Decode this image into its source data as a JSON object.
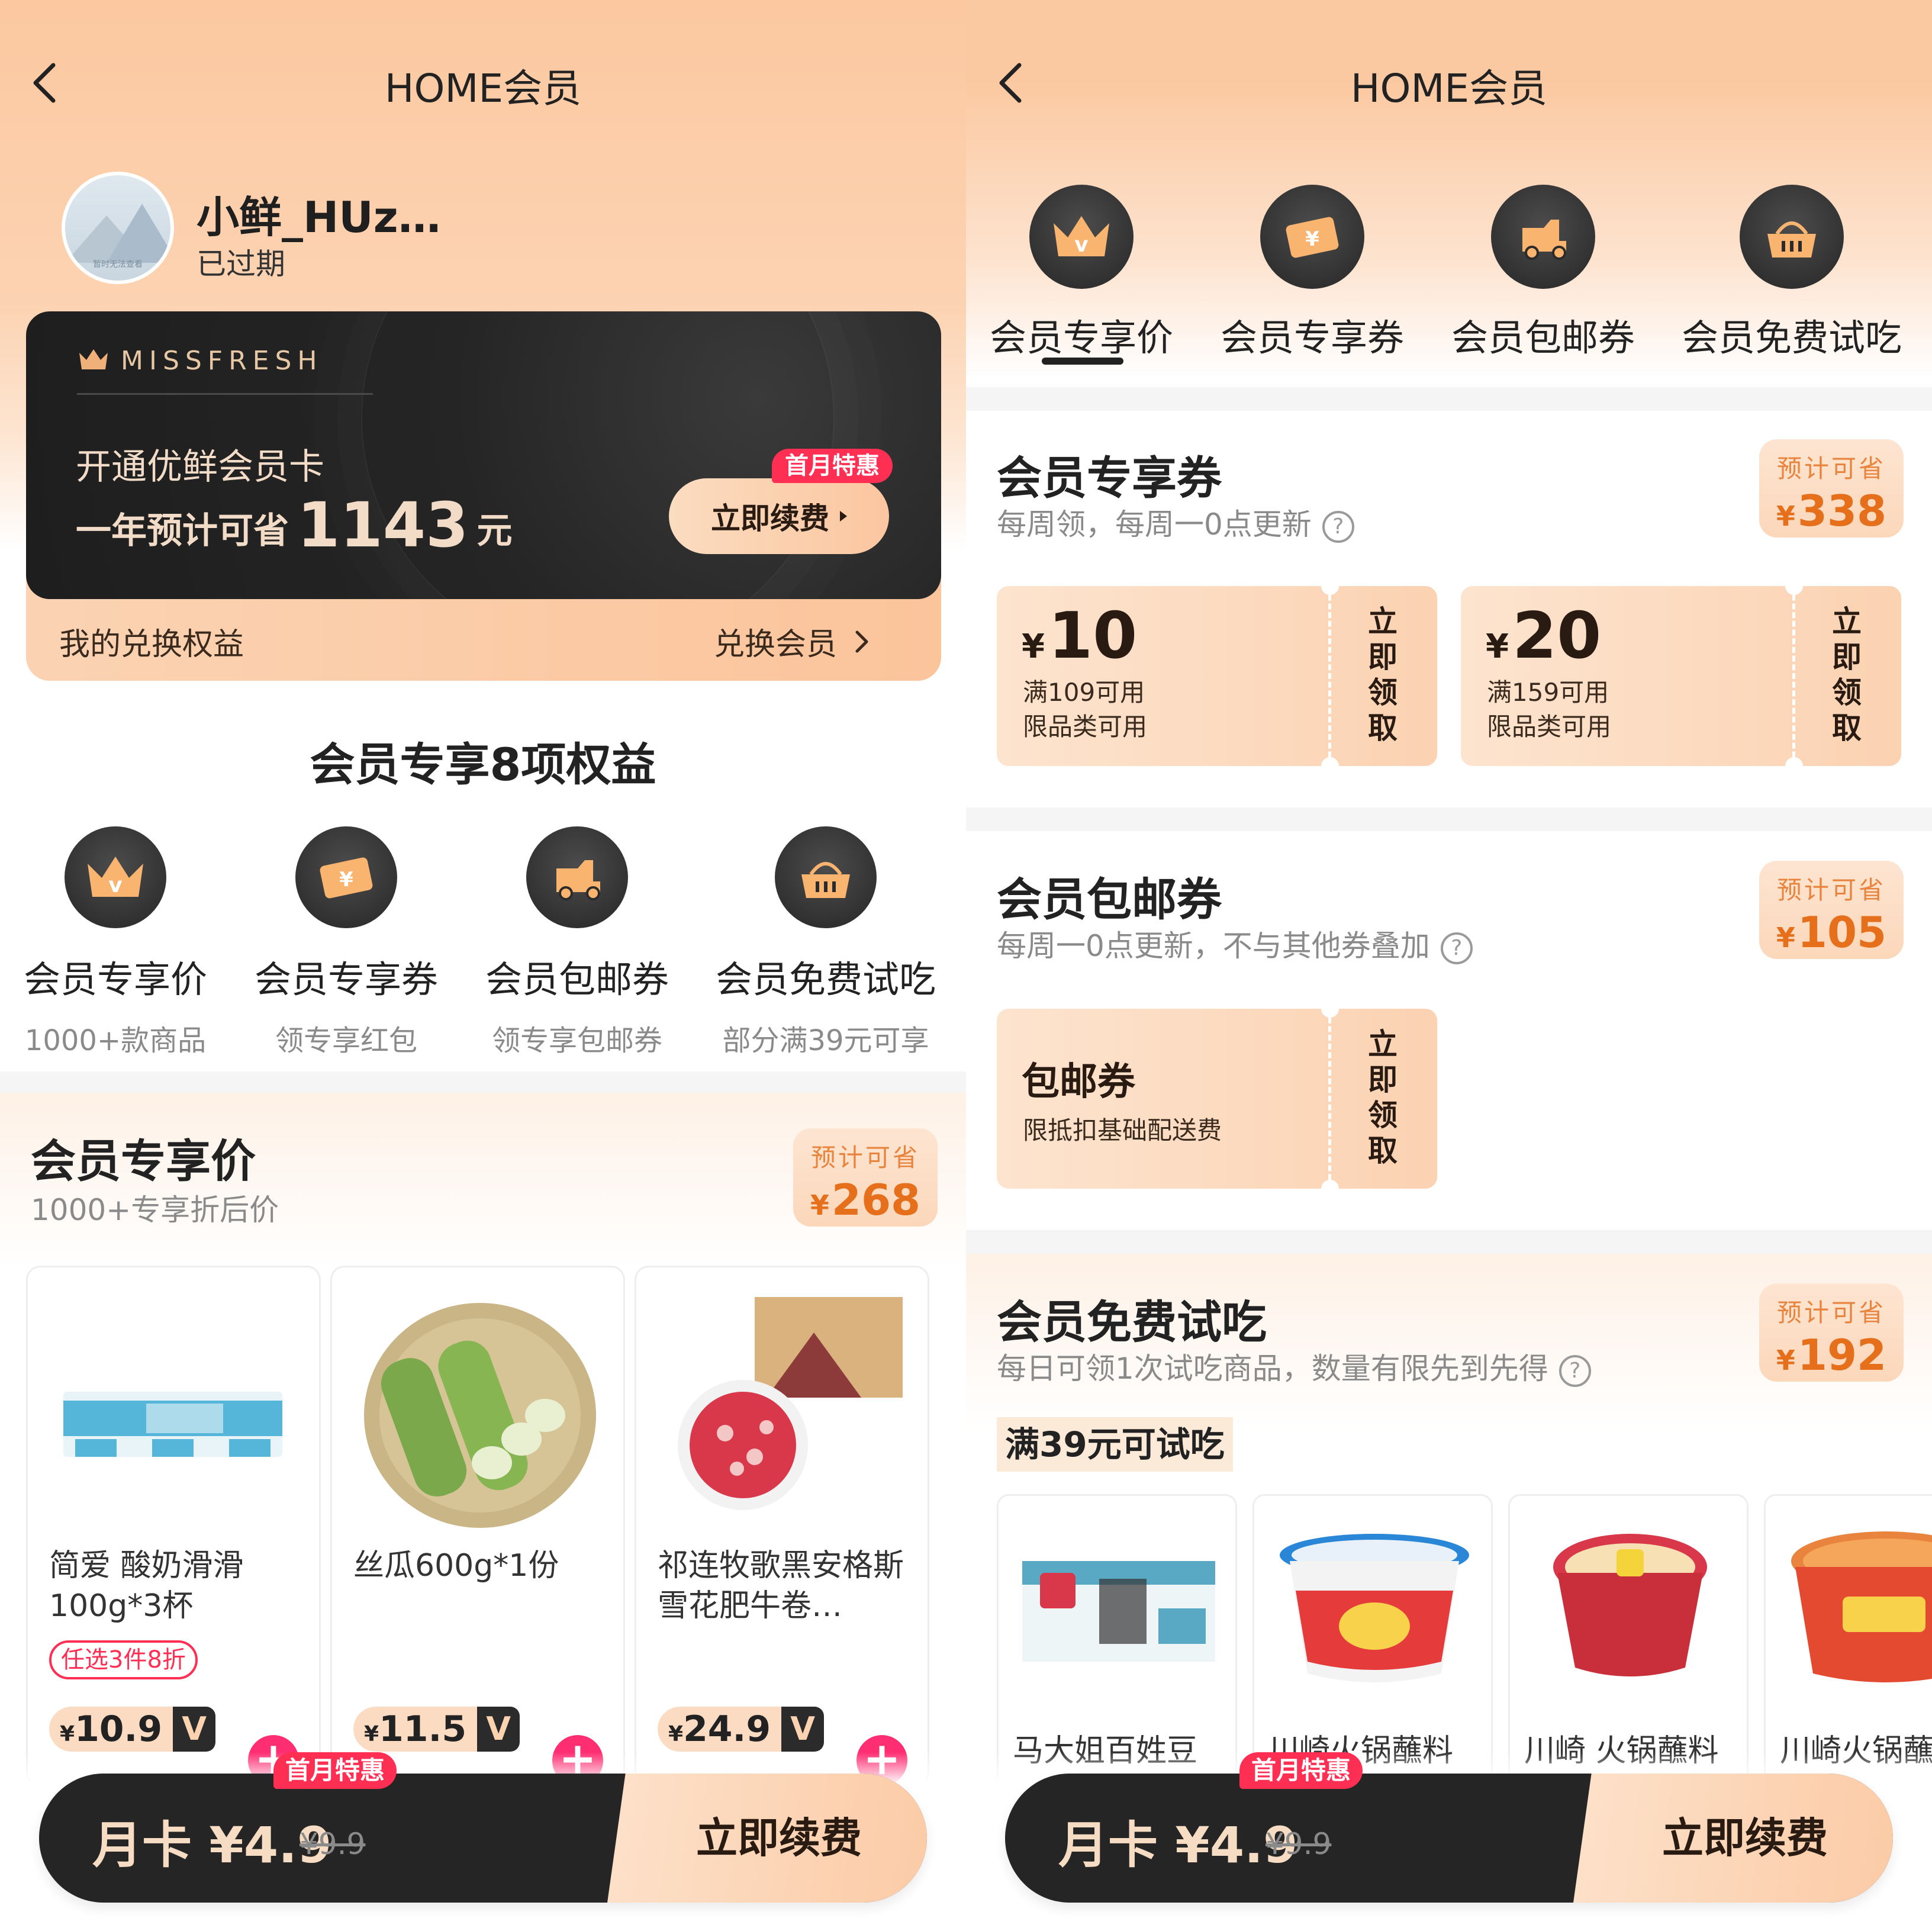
{
  "left": {
    "nav": {
      "title": "HOME会员"
    },
    "user": {
      "name": "小鲜_HUz…",
      "status": "已过期",
      "avatar_caption": "暂时无法查看"
    },
    "card": {
      "brand": "MISSFRESH",
      "line1": "开通优鲜会员卡",
      "line2_prefix": "一年预计可省",
      "line2_amount": "1143",
      "line2_suffix": "元",
      "badge": "首月特惠",
      "renew_label": "立即续费",
      "redeem_label": "我的兑换权益",
      "redeem_link": "兑换会员"
    },
    "benefits": {
      "title": "会员专享8项权益",
      "items": [
        {
          "label": "会员专享价",
          "sub": "1000+款商品",
          "icon": "crown-icon"
        },
        {
          "label": "会员专享券",
          "sub": "领专享红包",
          "icon": "coupon-icon"
        },
        {
          "label": "会员包邮券",
          "sub": "领专享包邮券",
          "icon": "delivery-truck-icon"
        },
        {
          "label": "会员免费试吃",
          "sub": "部分满39元可享",
          "icon": "basket-icon"
        }
      ]
    },
    "price_section": {
      "title": "会员专享价",
      "subtitle": "1000+专享折后价",
      "save_label": "预计可省",
      "save_currency": "¥",
      "save_value": "268",
      "products": [
        {
          "name": "简爱 酸奶滑滑100g*3杯",
          "tag": "任选3件8折",
          "currency": "¥",
          "price": "10.9",
          "vip": "V"
        },
        {
          "name": "丝瓜600g*1份",
          "tag": "",
          "currency": "¥",
          "price": "11.5",
          "vip": "V"
        },
        {
          "name": "祁连牧歌黑安格斯雪花肥牛卷…",
          "tag": "",
          "currency": "¥",
          "price": "24.9",
          "vip": "V"
        }
      ]
    },
    "bottom": {
      "badge": "首月特惠",
      "label": "月卡 ¥4.9",
      "original": "¥9.9",
      "cta": "立即续费"
    }
  },
  "right": {
    "nav": {
      "title": "HOME会员"
    },
    "tabs": [
      {
        "label": "会员专享价",
        "icon": "crown-icon",
        "active": true
      },
      {
        "label": "会员专享券",
        "icon": "coupon-icon",
        "active": false
      },
      {
        "label": "会员包邮券",
        "icon": "delivery-truck-icon",
        "active": false
      },
      {
        "label": "会员免费试吃",
        "icon": "basket-icon",
        "active": false
      }
    ],
    "coupon_section": {
      "title": "会员专享券",
      "subtitle": "每周领，每周一0点更新",
      "save_label": "预计可省",
      "save_currency": "¥",
      "save_value": "338",
      "coupons": [
        {
          "currency": "¥",
          "amount": "10",
          "cond": "满109可用",
          "scope": "限品类可用",
          "claim": "立即领取"
        },
        {
          "currency": "¥",
          "amount": "20",
          "cond": "满159可用",
          "scope": "限品类可用",
          "claim": "立即领取"
        }
      ]
    },
    "shipping_section": {
      "title": "会员包邮券",
      "subtitle": "每周一0点更新，不与其他券叠加",
      "save_label": "预计可省",
      "save_currency": "¥",
      "save_value": "105",
      "coupon": {
        "title": "包邮券",
        "desc": "限抵扣基础配送费",
        "claim": "立即领取"
      }
    },
    "trial_section": {
      "title": "会员免费试吃",
      "subtitle": "每日可领1次试吃商品，数量有限先到先得",
      "save_label": "预计可省",
      "save_currency": "¥",
      "save_value": "192",
      "tag": "满39元可试吃",
      "items": [
        {
          "name": "马大姐百姓豆"
        },
        {
          "name": "川崎火锅蘸料"
        },
        {
          "name": "川崎 火锅蘸料"
        },
        {
          "name": "川崎火锅蘸料"
        }
      ]
    },
    "bottom": {
      "badge": "首月特惠",
      "label": "月卡 ¥4.9",
      "original": "¥9.9",
      "cta": "立即续费"
    }
  },
  "colors": {
    "peach": "#fbc8a0",
    "card_dark": "#1e1e1e",
    "accent_orange": "#e66f1b",
    "badge_red": "#ff2f54",
    "add_pink": "#ff2e73"
  }
}
